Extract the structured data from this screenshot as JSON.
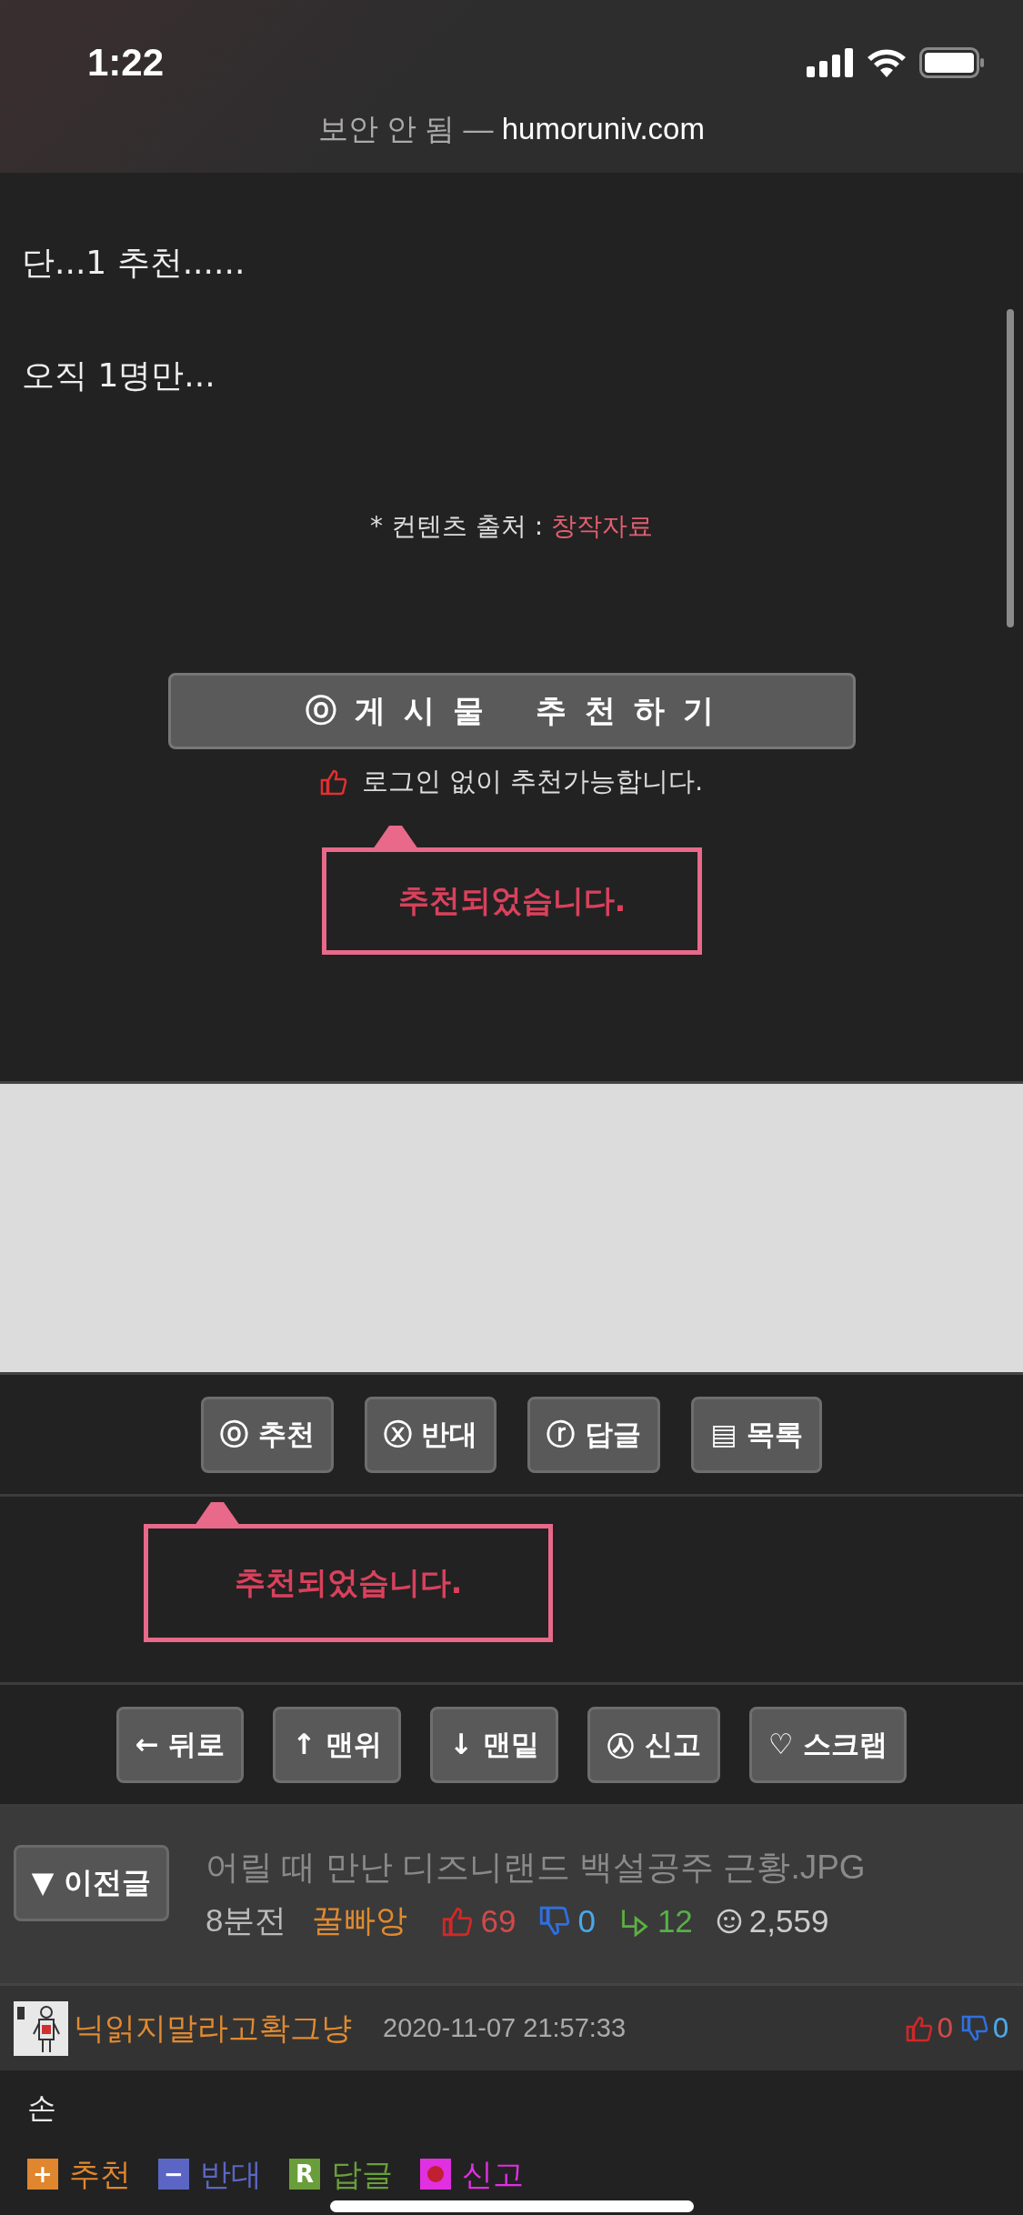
{
  "status_bar": {
    "time": "1:22"
  },
  "address_bar": {
    "security": "보안 안 됨",
    "separator": "—",
    "domain": "humoruniv.com"
  },
  "post": {
    "paragraphs": [
      "단...1 추천......",
      "오직 1명만..."
    ],
    "source_label": "* 컨텐츠 출처 :",
    "source_link": "창작자료"
  },
  "recommend_button": "ⓞ 게 시 물 　추 천 하 기",
  "recommend_note": "로그인 없이 추천가능합니다.",
  "recommend_popup": {
    "message": "추천되었습니다."
  },
  "action_bar": [
    {
      "label": "ⓞ 추천"
    },
    {
      "label": "ⓧ 반대"
    },
    {
      "label": "ⓡ 답글"
    },
    {
      "label": "▤ 목록"
    }
  ],
  "action_popup": {
    "message": "추천되었습니다."
  },
  "nav_bar": [
    {
      "label": "← 뒤로"
    },
    {
      "label": "↑ 맨위"
    },
    {
      "label": "↓ 맨밑"
    },
    {
      "label": "㉦ 신고"
    },
    {
      "label": "♡ 스크랩"
    }
  ],
  "previous_post": {
    "button": "▼ 이전글",
    "title": "어릴 때 만난 디즈니랜드 백설공주 근황.JPG",
    "time": "8분전",
    "author": "꿀빠앙",
    "likes": "69",
    "dislikes": "0",
    "replies": "12",
    "views": "2,559"
  },
  "comment": {
    "author": "닉읽지말라고확그냥",
    "date": "2020-11-07 21:57:33",
    "likes": "0",
    "dislikes": "0",
    "text": "손",
    "actions": [
      {
        "kind": "plus",
        "icon_text": "+",
        "label": "추천",
        "color": "#e0862e"
      },
      {
        "kind": "minus",
        "icon_text": "−",
        "label": "반대",
        "color": "#5b66c4"
      },
      {
        "kind": "reply",
        "icon_text": "R",
        "label": "답글",
        "color": "#6a9e3a"
      },
      {
        "kind": "report",
        "label": "신고",
        "color": "#e030e0"
      }
    ]
  }
}
